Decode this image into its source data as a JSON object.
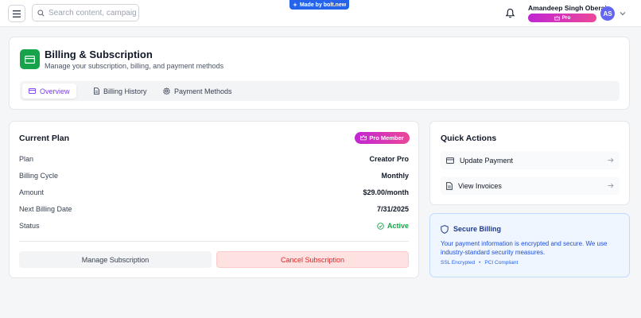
{
  "topbar": {
    "search_placeholder": "Search content, campaign",
    "bolt_badge": "Made by bolt.new",
    "user_name": "Amandeep Singh Oberai",
    "user_plan": "Pro",
    "avatar_initials": "AS"
  },
  "header": {
    "title": "Billing & Subscription",
    "subtitle": "Manage your subscription, billing, and payment methods",
    "tabs": [
      {
        "label": "Overview",
        "icon": "credit-card-icon",
        "active": true
      },
      {
        "label": "Billing History",
        "icon": "document-icon",
        "active": false
      },
      {
        "label": "Payment Methods",
        "icon": "gear-icon",
        "active": false
      }
    ]
  },
  "plan": {
    "title": "Current Plan",
    "badge": "Pro Member",
    "rows": [
      {
        "label": "Plan",
        "value": "Creator Pro"
      },
      {
        "label": "Billing Cycle",
        "value": "Monthly"
      },
      {
        "label": "Amount",
        "value": "$29.00/month"
      },
      {
        "label": "Next Billing Date",
        "value": "7/31/2025"
      },
      {
        "label": "Status",
        "value": "Active"
      }
    ],
    "manage_label": "Manage Subscription",
    "cancel_label": "Cancel Subscription"
  },
  "quick_actions": {
    "title": "Quick Actions",
    "items": [
      {
        "label": "Update Payment",
        "icon": "credit-card-icon"
      },
      {
        "label": "View Invoices",
        "icon": "document-icon"
      }
    ]
  },
  "security": {
    "title": "Secure Billing",
    "text": "Your payment information is encrypted and secure. We use industry-standard security measures.",
    "tags": [
      "SSL Encrypted",
      "•",
      "PCI Compliant"
    ]
  },
  "colors": {
    "accent": "#7c3aed",
    "brand_green": "#16a34a",
    "pro_gradient_start": "#c026d3",
    "pro_gradient_end": "#ec4899",
    "active_status": "#16a34a",
    "cancel_red": "#dc2626"
  }
}
